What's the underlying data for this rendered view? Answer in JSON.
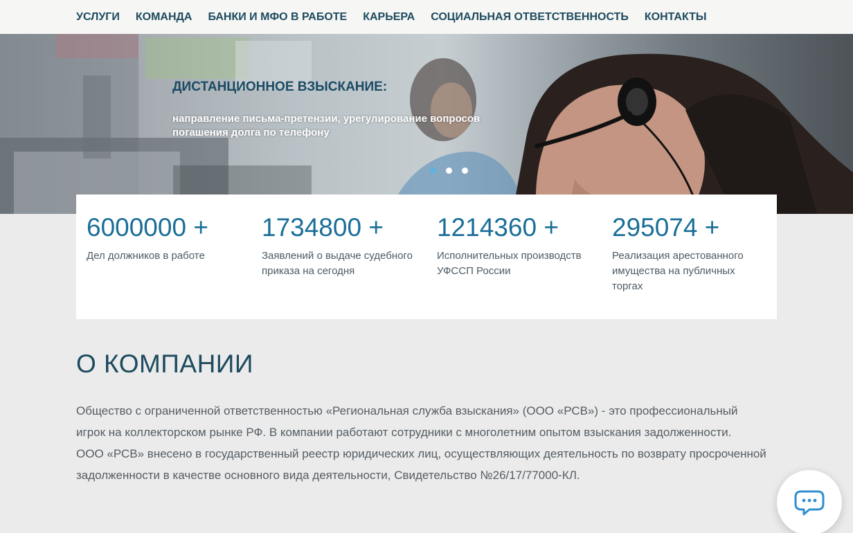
{
  "nav": {
    "items": [
      {
        "label": "УСЛУГИ"
      },
      {
        "label": "КОМАНДА"
      },
      {
        "label": "БАНКИ И МФО В РАБОТЕ"
      },
      {
        "label": "КАРЬЕРА"
      },
      {
        "label": "СОЦИАЛЬНАЯ ОТВЕТСТВЕННОСТЬ"
      },
      {
        "label": "КОНТАКТЫ"
      }
    ]
  },
  "hero": {
    "title": "ДИСТАНЦИОННОЕ ВЗЫСКАНИЕ:",
    "subtitle": "направление письма-претензии, урегулирование вопросов погашения долга по телефону",
    "slides": 3,
    "active_slide": 1
  },
  "stats": [
    {
      "value": "6000000 +",
      "label": "Дел должников в работе"
    },
    {
      "value": "1734800 +",
      "label": "Заявлений о выдаче судебного приказа на сегодня"
    },
    {
      "value": "1214360 +",
      "label": "Исполнительных производств УФССП России"
    },
    {
      "value": "295074 +",
      "label": "Реализация арестованного имущества на публичных торгах"
    }
  ],
  "about": {
    "title": "О КОМПАНИИ",
    "paragraph1": "Общество с ограниченной ответственностью «Региональная служба взыскания» (ООО «РСВ») - это профессиональный игрок на коллекторском рынке РФ. В компании работают сотрудники с многолетним опытом взыскания задолженности.",
    "paragraph2": "ООО «РСВ» внесено в государственный реестр юридических лиц, осуществляющих деятельность по возврату просроченной задолженности в качестве основного вида деятельности, Свидетельство №26/17/77000-КЛ."
  },
  "chat": {
    "icon": "chat-bubble-icon"
  },
  "colors": {
    "nav_text": "#1d4a5e",
    "stat_number": "#1a6d98",
    "dot_active": "#5fb2de",
    "page_bg": "#ebebeb"
  }
}
